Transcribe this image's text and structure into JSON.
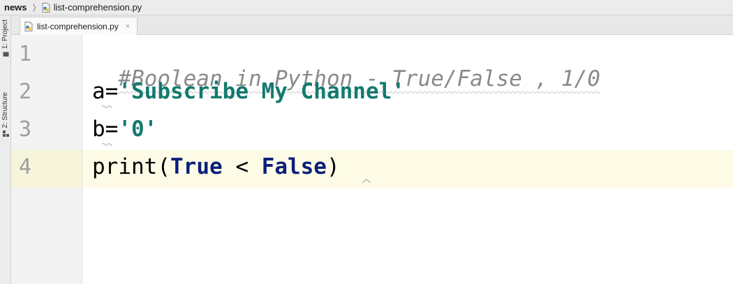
{
  "navbar": {
    "project": "news",
    "file": "list-comprehension.py"
  },
  "toolstrip": {
    "project_tab": "1: Project",
    "structure_tab": "2: Structure"
  },
  "tabs": [
    {
      "label": "list-comprehension.py",
      "close": "×"
    }
  ],
  "editor": {
    "lines": [
      {
        "number": "1",
        "comment": "#Boolean in Python - True/False , 1/0"
      },
      {
        "number": "2",
        "var": "a",
        "op": "=",
        "string": "'Subscribe My Channel'"
      },
      {
        "number": "3",
        "var": "b",
        "op": "=",
        "string": "'0'"
      },
      {
        "number": "4",
        "func": "print",
        "open": "(",
        "kw1": "True",
        "op": " < ",
        "kw2": "False",
        "close": ")"
      }
    ]
  },
  "colors": {
    "comment": "#8a8a8a",
    "string": "#127a6e",
    "keyword": "#0b1f7a",
    "current_line": "#fdfbe6"
  }
}
